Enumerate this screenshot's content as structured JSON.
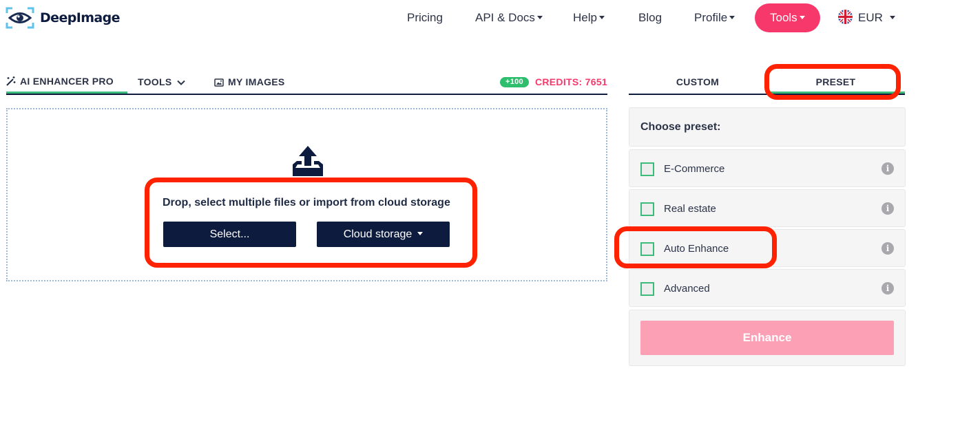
{
  "brand": {
    "name": "DeepImage"
  },
  "nav": {
    "pricing": "Pricing",
    "api_docs": "API & Docs",
    "help": "Help",
    "blog": "Blog",
    "profile": "Profile",
    "tools": "Tools",
    "currency": "EUR"
  },
  "tabs": {
    "enhancer": "AI ENHANCER PRO",
    "tools": "TOOLS",
    "my_images": "MY IMAGES",
    "credits_bonus": "+100",
    "credits": "CREDITS: 7651"
  },
  "upload": {
    "prompt": "Drop, select multiple files or import from cloud storage",
    "select_label": "Select...",
    "cloud_label": "Cloud storage"
  },
  "right_panel": {
    "tab_custom": "CUSTOM",
    "tab_preset": "PRESET",
    "choose_title": "Choose preset:",
    "presets": [
      {
        "label": "E-Commerce",
        "checked": false
      },
      {
        "label": "Real estate",
        "checked": false
      },
      {
        "label": "Auto Enhance",
        "checked": false
      },
      {
        "label": "Advanced",
        "checked": false
      }
    ],
    "enhance_label": "Enhance"
  },
  "colors": {
    "accent_pink": "#f7386b",
    "navy": "#0d1b3e",
    "green": "#3dbb7a",
    "annotation_red": "#ff2200"
  }
}
